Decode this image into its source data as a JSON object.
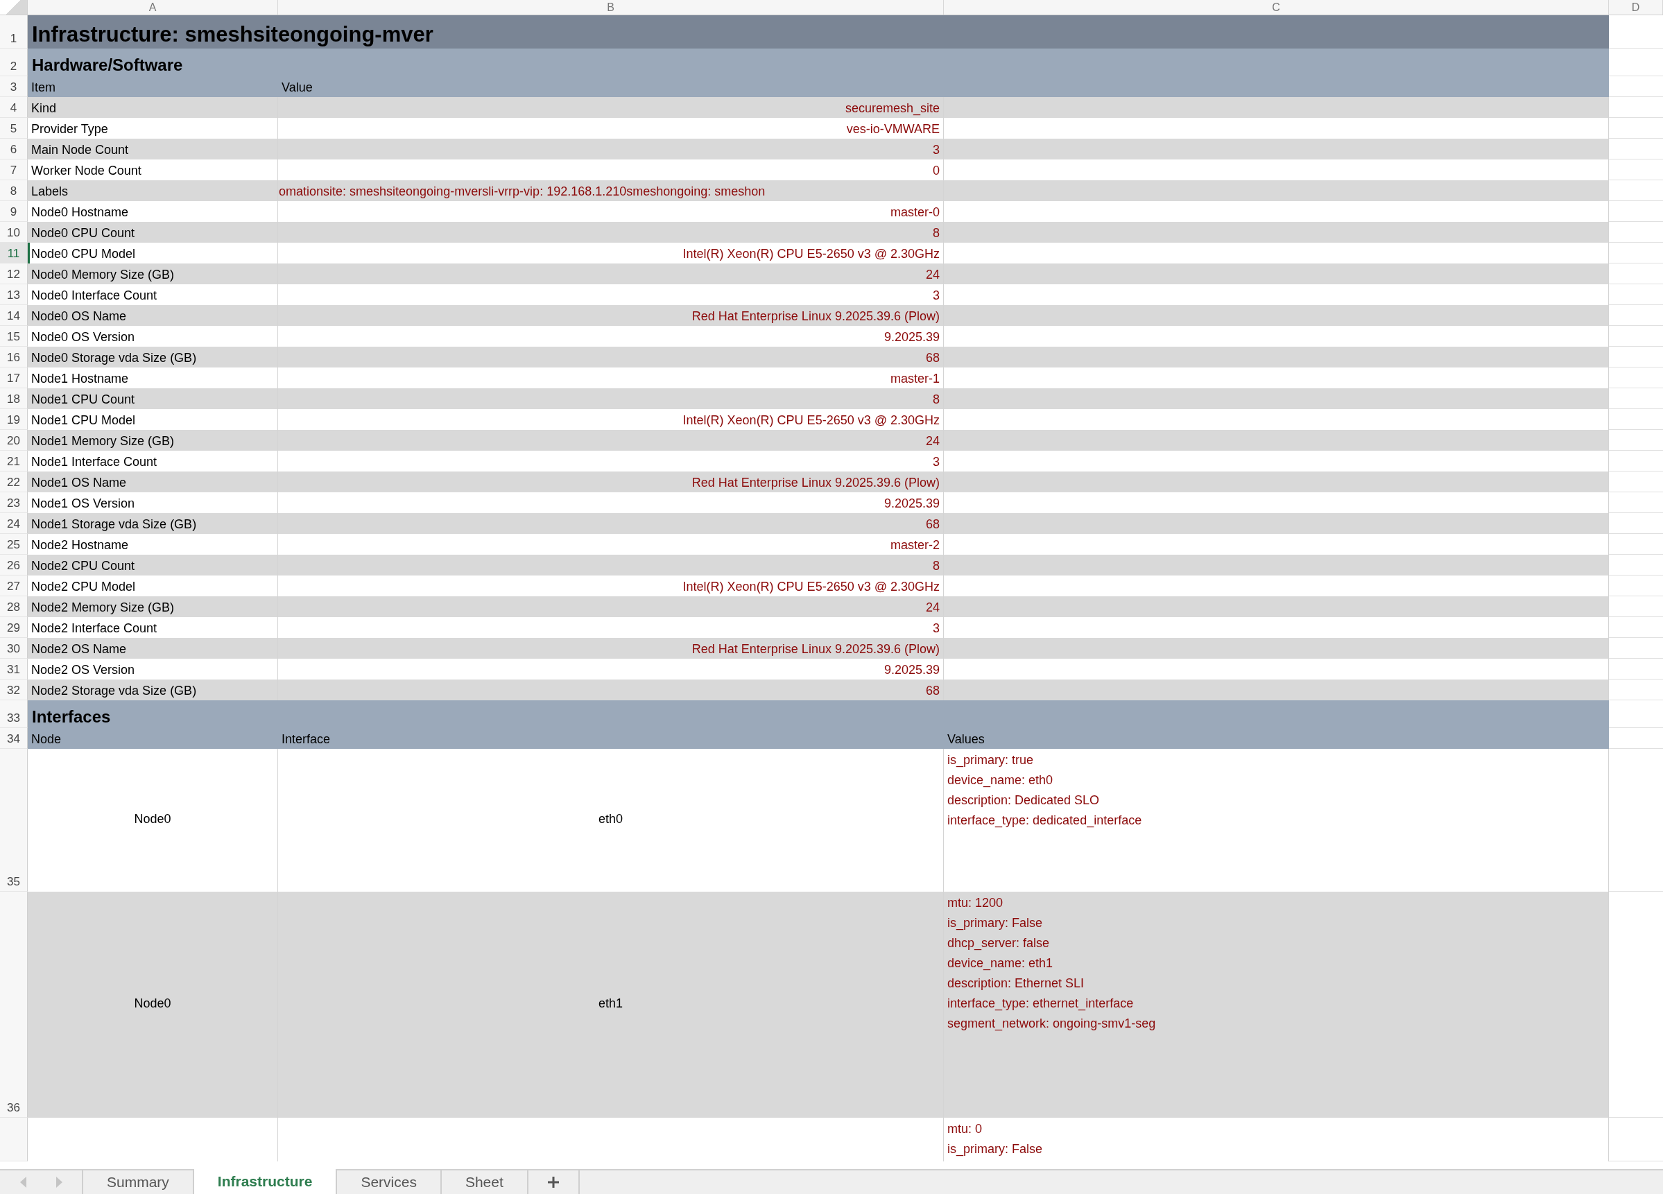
{
  "column_headers": [
    "A",
    "B",
    "C",
    "D"
  ],
  "rows": [
    {
      "kind": "title",
      "number": "1",
      "selected": false,
      "text": "Infrastructure: smeshsiteongoing-mver"
    },
    {
      "kind": "section",
      "number": "2",
      "selected": false,
      "text": "Hardware/Software"
    },
    {
      "kind": "header",
      "number": "3",
      "selected": false,
      "cells": [
        "Item",
        "Value"
      ]
    },
    {
      "kind": "data",
      "number": "4",
      "selected": false,
      "item": "Kind",
      "value": "securemesh_site"
    },
    {
      "kind": "data",
      "number": "5",
      "selected": false,
      "item": "Provider Type",
      "value": "ves-io-VMWARE"
    },
    {
      "kind": "data",
      "number": "6",
      "selected": false,
      "item": "Main Node Count",
      "value": "3"
    },
    {
      "kind": "data",
      "number": "7",
      "selected": false,
      "item": "Worker Node Count",
      "value": "0"
    },
    {
      "kind": "clipped",
      "number": "8",
      "selected": false,
      "item": "Labels",
      "value": "omationsite: smeshsiteongoing-mversli-vrrp-vip: 192.168.1.210smeshongoing: smeshon"
    },
    {
      "kind": "data",
      "number": "9",
      "selected": false,
      "item": "Node0 Hostname",
      "value": "master-0"
    },
    {
      "kind": "data",
      "number": "10",
      "selected": false,
      "item": "Node0 CPU Count",
      "value": "8"
    },
    {
      "kind": "data",
      "number": "11",
      "selected": true,
      "item": "Node0 CPU Model",
      "value": "Intel(R) Xeon(R) CPU E5-2650 v3 @ 2.30GHz"
    },
    {
      "kind": "data",
      "number": "12",
      "selected": false,
      "item": "Node0 Memory Size (GB)",
      "value": "24"
    },
    {
      "kind": "data",
      "number": "13",
      "selected": false,
      "item": "Node0 Interface Count",
      "value": "3"
    },
    {
      "kind": "data",
      "number": "14",
      "selected": false,
      "item": "Node0 OS Name",
      "value": "Red Hat Enterprise Linux 9.2025.39.6 (Plow)"
    },
    {
      "kind": "data",
      "number": "15",
      "selected": false,
      "item": "Node0 OS Version",
      "value": "9.2025.39"
    },
    {
      "kind": "data",
      "number": "16",
      "selected": false,
      "item": "Node0 Storage vda Size (GB)",
      "value": "68"
    },
    {
      "kind": "data",
      "number": "17",
      "selected": false,
      "item": "Node1 Hostname",
      "value": "master-1"
    },
    {
      "kind": "data",
      "number": "18",
      "selected": false,
      "item": "Node1 CPU Count",
      "value": "8"
    },
    {
      "kind": "data",
      "number": "19",
      "selected": false,
      "item": "Node1 CPU Model",
      "value": "Intel(R) Xeon(R) CPU E5-2650 v3 @ 2.30GHz"
    },
    {
      "kind": "data",
      "number": "20",
      "selected": false,
      "item": "Node1 Memory Size (GB)",
      "value": "24"
    },
    {
      "kind": "data",
      "number": "21",
      "selected": false,
      "item": "Node1 Interface Count",
      "value": "3"
    },
    {
      "kind": "data",
      "number": "22",
      "selected": false,
      "item": "Node1 OS Name",
      "value": "Red Hat Enterprise Linux 9.2025.39.6 (Plow)"
    },
    {
      "kind": "data",
      "number": "23",
      "selected": false,
      "item": "Node1 OS Version",
      "value": "9.2025.39"
    },
    {
      "kind": "data",
      "number": "24",
      "selected": false,
      "item": "Node1 Storage vda Size (GB)",
      "value": "68"
    },
    {
      "kind": "data",
      "number": "25",
      "selected": false,
      "item": "Node2 Hostname",
      "value": "master-2"
    },
    {
      "kind": "data",
      "number": "26",
      "selected": false,
      "item": "Node2 CPU Count",
      "value": "8"
    },
    {
      "kind": "data",
      "number": "27",
      "selected": false,
      "item": "Node2 CPU Model",
      "value": "Intel(R) Xeon(R) CPU E5-2650 v3 @ 2.30GHz"
    },
    {
      "kind": "data",
      "number": "28",
      "selected": false,
      "item": "Node2 Memory Size (GB)",
      "value": "24"
    },
    {
      "kind": "data",
      "number": "29",
      "selected": false,
      "item": "Node2 Interface Count",
      "value": "3"
    },
    {
      "kind": "data",
      "number": "30",
      "selected": false,
      "item": "Node2 OS Name",
      "value": "Red Hat Enterprise Linux 9.2025.39.6 (Plow)"
    },
    {
      "kind": "data",
      "number": "31",
      "selected": false,
      "item": "Node2 OS Version",
      "value": "9.2025.39"
    },
    {
      "kind": "data",
      "number": "32",
      "selected": false,
      "item": "Node2 Storage vda Size (GB)",
      "value": "68"
    },
    {
      "kind": "section",
      "number": "33",
      "selected": false,
      "text": "Interfaces"
    },
    {
      "kind": "header",
      "number": "34",
      "selected": false,
      "cells": [
        "Node",
        "Interface",
        "Values"
      ]
    },
    {
      "kind": "interface",
      "number": "35",
      "selected": false,
      "node": "Node0",
      "interface": "eth0",
      "values": [
        "is_primary: true",
        "device_name: eth0",
        "description: Dedicated SLO",
        "interface_type: dedicated_interface"
      ]
    },
    {
      "kind": "interface",
      "number": "36",
      "selected": false,
      "node": "Node0",
      "interface": "eth1",
      "values": [
        "mtu: 1200",
        "is_primary: False",
        "dhcp_server: false",
        "device_name: eth1",
        "description: Ethernet SLI",
        "interface_type: ethernet_interface",
        "segment_network: ongoing-smv1-seg"
      ]
    }
  ],
  "cut_off_row": {
    "values": [
      "mtu: 0",
      "is_primary: False"
    ]
  },
  "sheet_tabs": [
    {
      "label": "Summary",
      "selected": false
    },
    {
      "label": "Infrastructure",
      "selected": true
    },
    {
      "label": "Services",
      "selected": false
    },
    {
      "label": "Sheet",
      "selected": false
    }
  ]
}
